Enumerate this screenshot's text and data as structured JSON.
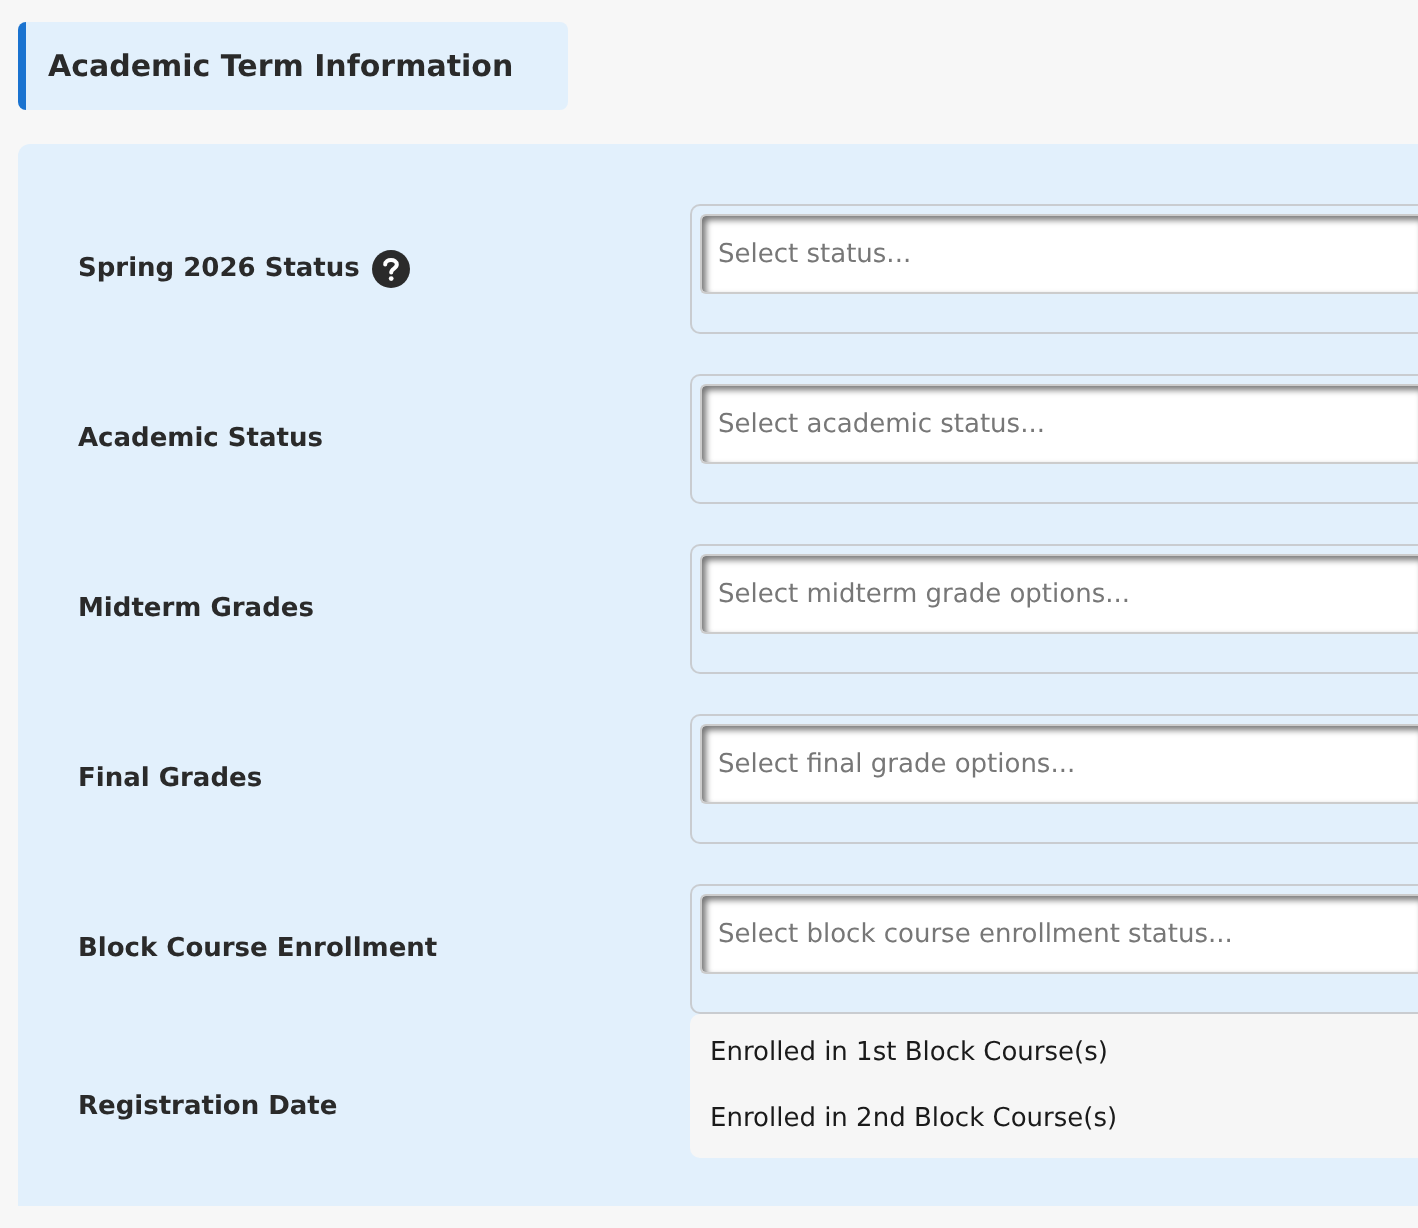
{
  "section": {
    "title": "Academic Term Information"
  },
  "fields": [
    {
      "label": "Spring 2026 Status",
      "help": true,
      "kind": "select",
      "placeholder": "Select status..."
    },
    {
      "label": "Academic Status",
      "help": false,
      "kind": "select",
      "placeholder": "Select academic status..."
    },
    {
      "label": "Midterm Grades",
      "help": false,
      "kind": "select",
      "placeholder": "Select midterm grade options..."
    },
    {
      "label": "Final Grades",
      "help": false,
      "kind": "select",
      "placeholder": "Select final grade options..."
    },
    {
      "label": "Block Course Enrollment",
      "help": false,
      "kind": "select",
      "placeholder": "Select block course enrollment status..."
    },
    {
      "label": "Registration Date",
      "help": false,
      "kind": "options",
      "options": [
        "Enrolled in 1st Block Course(s)",
        "Enrolled in 2nd Block Course(s)"
      ]
    }
  ]
}
